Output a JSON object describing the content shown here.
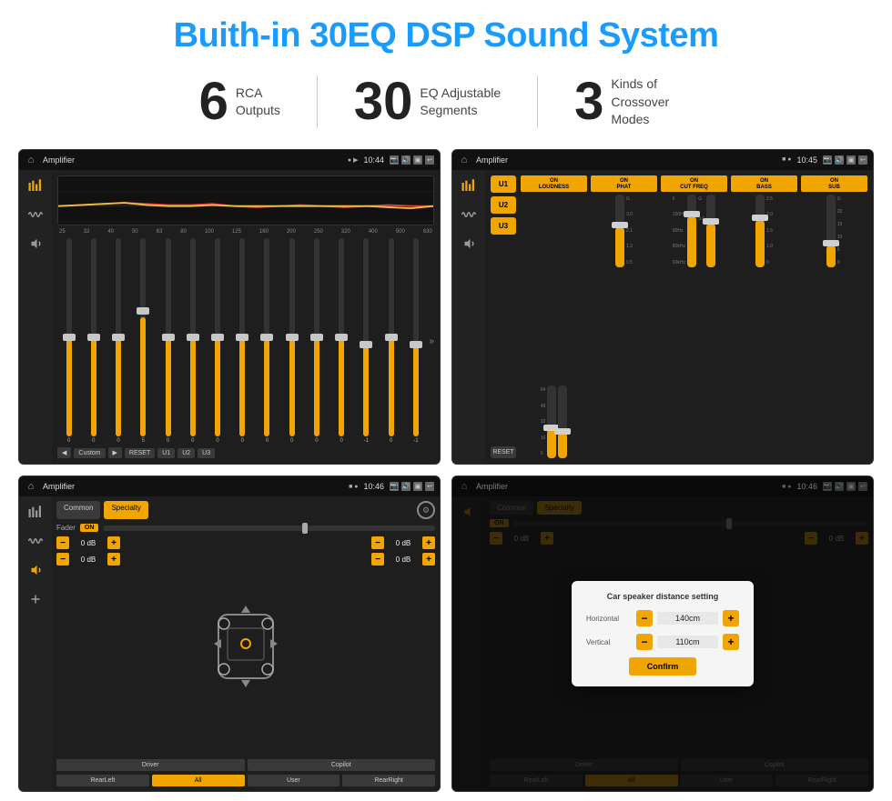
{
  "page": {
    "title": "Buith-in 30EQ DSP Sound System",
    "features": [
      {
        "number": "6",
        "text": "RCA\nOutputs"
      },
      {
        "number": "30",
        "text": "EQ Adjustable\nSegments"
      },
      {
        "number": "3",
        "text": "Kinds of\nCrossover Modes"
      }
    ]
  },
  "screen1": {
    "app": "Amplifier",
    "time": "10:44",
    "eq_freqs": [
      "25",
      "32",
      "40",
      "50",
      "63",
      "80",
      "100",
      "125",
      "160",
      "200",
      "250",
      "320",
      "400",
      "500",
      "630"
    ],
    "eq_values": [
      "0",
      "0",
      "0",
      "5",
      "0",
      "0",
      "0",
      "0",
      "0",
      "0",
      "0",
      "0",
      "-1",
      "0",
      "-1"
    ],
    "preset_label": "Custom",
    "buttons": [
      "RESET",
      "U1",
      "U2",
      "U3"
    ]
  },
  "screen2": {
    "app": "Amplifier",
    "time": "10:45",
    "presets": [
      "U1",
      "U2",
      "U3"
    ],
    "channels": [
      {
        "label": "LOUDNESS",
        "on": true,
        "sublabel": ""
      },
      {
        "label": "PHAT",
        "on": true,
        "sublabel": ""
      },
      {
        "label": "CUT FREQ",
        "on": true,
        "sublabel": ""
      },
      {
        "label": "BASS",
        "on": true,
        "sublabel": ""
      },
      {
        "label": "SUB",
        "on": true,
        "sublabel": ""
      }
    ],
    "reset_label": "RESET"
  },
  "screen3": {
    "app": "Amplifier",
    "time": "10:46",
    "tabs": [
      "Common",
      "Specialty"
    ],
    "active_tab": "Specialty",
    "fader_label": "Fader",
    "fader_on": "ON",
    "volumes": [
      "0 dB",
      "0 dB",
      "0 dB",
      "0 dB"
    ],
    "buttons": [
      "Driver",
      "Copilot",
      "RearLeft",
      "All",
      "User",
      "RearRight"
    ]
  },
  "screen4": {
    "app": "Amplifier",
    "time": "10:46",
    "tabs": [
      "Common",
      "Specialty"
    ],
    "active_tab": "Specialty",
    "fader_on": "ON",
    "dialog": {
      "title": "Car speaker distance setting",
      "horizontal_label": "Horizontal",
      "horizontal_value": "140cm",
      "vertical_label": "Vertical",
      "vertical_value": "110cm",
      "confirm_label": "Confirm"
    },
    "bottom_buttons": [
      "Driver",
      "Copilot",
      "RearLeft",
      "All",
      "User",
      "RearRight"
    ]
  }
}
